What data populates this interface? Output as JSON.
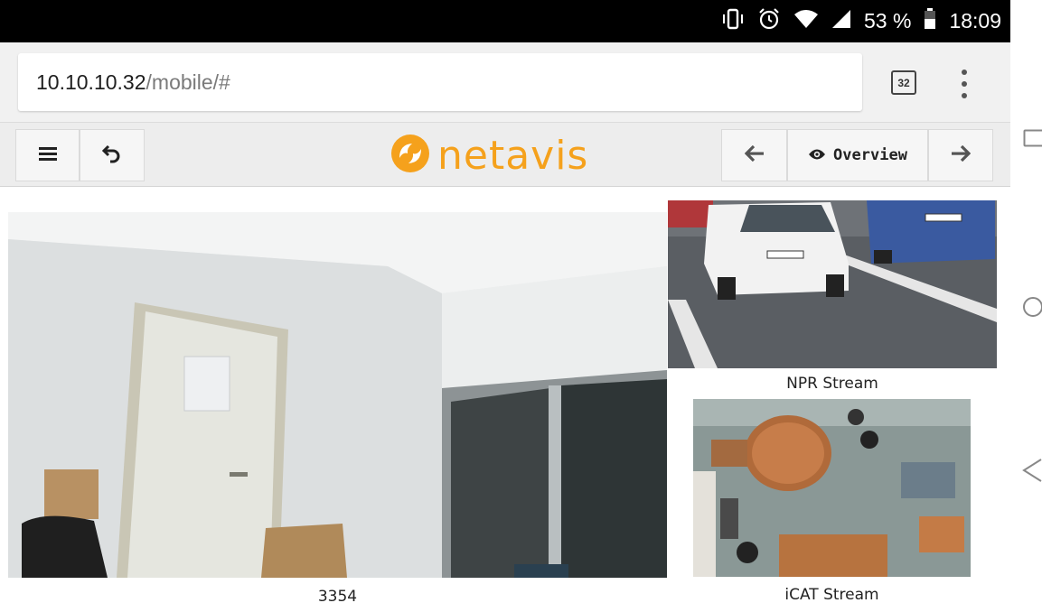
{
  "status": {
    "battery_pct": "53 %",
    "time": "18:09"
  },
  "browser": {
    "url_host": "10.10.10.32",
    "url_path": "/mobile/#",
    "tab_count": "32"
  },
  "toolbar": {
    "brand": "netavis",
    "overview_label": "Overview"
  },
  "cameras": [
    {
      "label": "3354"
    },
    {
      "label": "NPR Stream"
    },
    {
      "label": "iCAT Stream"
    }
  ],
  "icons": {
    "status": [
      "vibrate-icon",
      "alarm-icon",
      "wifi-icon",
      "signal-icon",
      "battery-icon"
    ],
    "toolbar": [
      "menu-icon",
      "undo-icon",
      "netavis-logo-icon",
      "arrow-left-icon",
      "eye-icon",
      "arrow-right-icon"
    ],
    "nav": [
      "recents-icon",
      "home-icon",
      "back-icon"
    ]
  },
  "colors": {
    "brand_orange": "#f5a11c",
    "status_bar": "#000000",
    "toolbar_bg": "#ededed"
  }
}
